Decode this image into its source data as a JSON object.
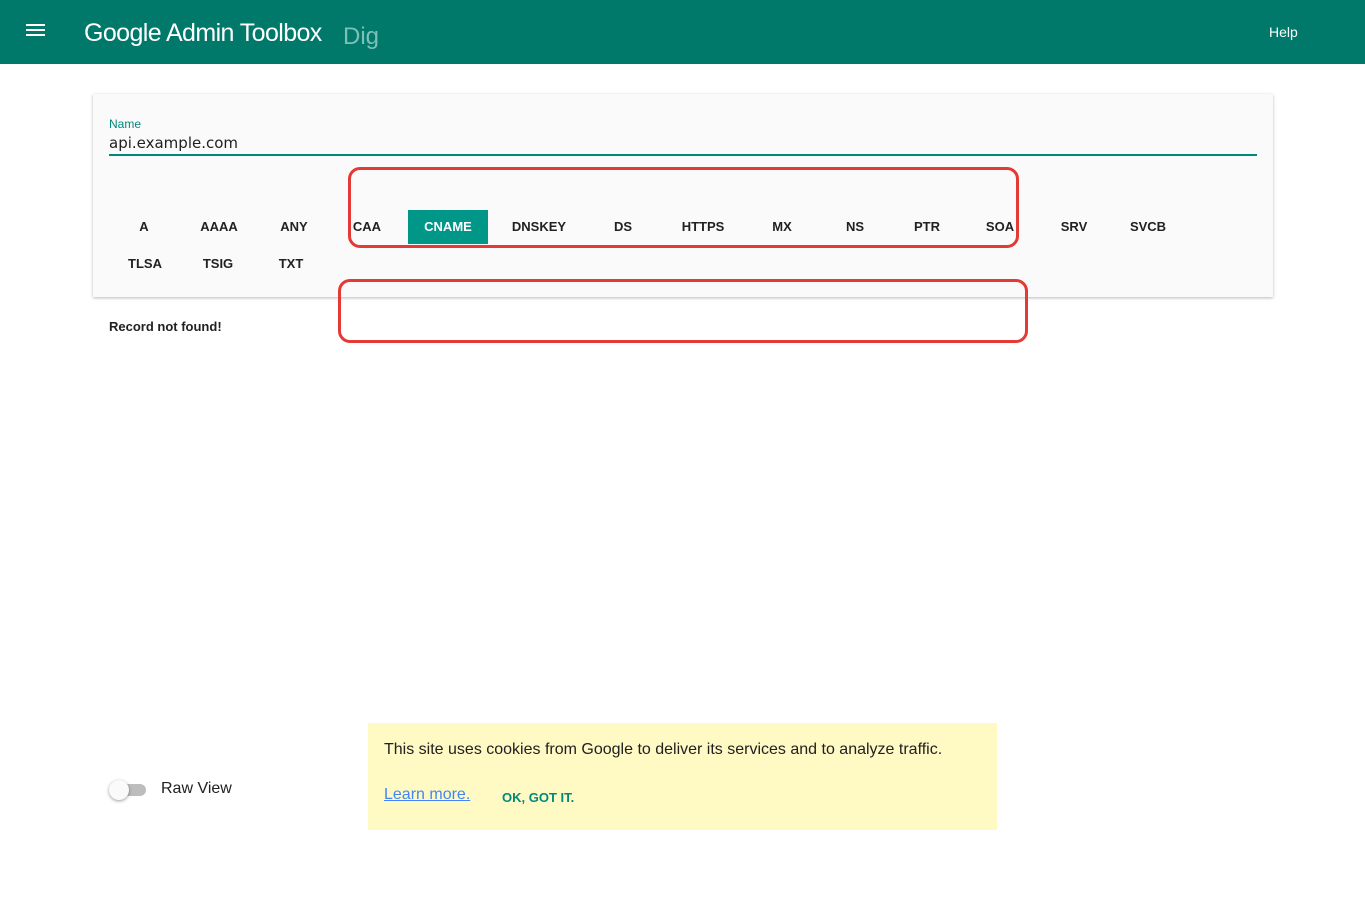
{
  "header": {
    "title": "Google Admin Toolbox",
    "subtitle": "Dig",
    "help_label": "Help",
    "menu_icon": "hamburger-menu-icon",
    "background_color": "#00796b"
  },
  "form": {
    "name_label": "Name",
    "name_value": "api.example.com",
    "accent_color": "#00897b"
  },
  "record_types": {
    "selected": "CNAME",
    "row1": [
      "A",
      "AAAA",
      "ANY",
      "CAA",
      "CNAME",
      "DNSKEY",
      "DS",
      "HTTPS",
      "MX",
      "NS",
      "PTR",
      "SOA",
      "SRV",
      "SVCB"
    ],
    "row2": [
      "TLSA",
      "TSIG",
      "TXT"
    ],
    "selected_color": "#009688"
  },
  "result": {
    "message": "Record not found!"
  },
  "raw_view": {
    "label": "Raw View",
    "enabled": false
  },
  "cookie_notice": {
    "text": "This site uses cookies from Google to deliver its services and to analyze traffic.",
    "learn_more": "Learn more.",
    "ok_label": "OK, GOT IT.",
    "background_color": "#fff9c4"
  },
  "annotations": {
    "highlight_color": "#e53935"
  }
}
